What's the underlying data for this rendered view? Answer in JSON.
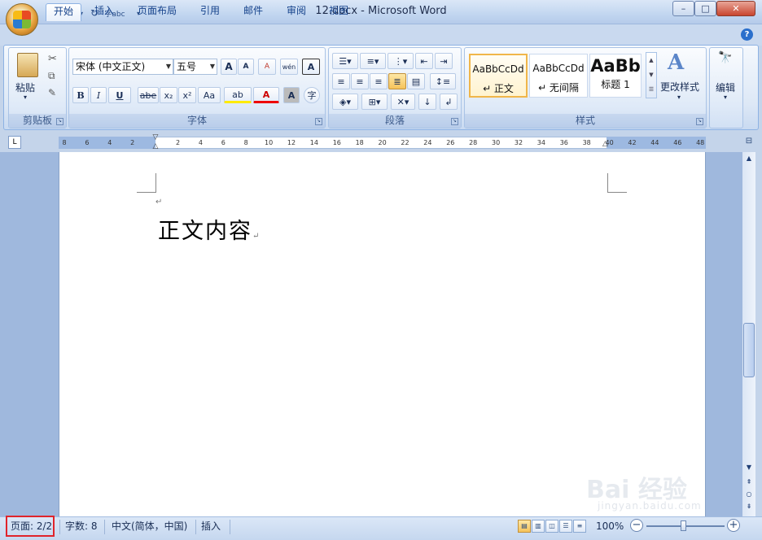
{
  "window": {
    "title": "12.docx - Microsoft Word",
    "min": "–",
    "max": "□",
    "close": "✕"
  },
  "qat": {
    "save": "💾",
    "undo": "↶",
    "redo": "↻",
    "abc": "字abc",
    "more": "▾"
  },
  "tabs": [
    {
      "label": "开始",
      "active": true
    },
    {
      "label": "插入"
    },
    {
      "label": "页面布局"
    },
    {
      "label": "引用"
    },
    {
      "label": "邮件"
    },
    {
      "label": "审阅"
    },
    {
      "label": "视图"
    }
  ],
  "clipboard": {
    "paste": "粘贴",
    "group": "剪贴板"
  },
  "font": {
    "family": "宋体 (中文正文)",
    "size": "五号",
    "grow": "A",
    "shrink": "A",
    "clear": "A",
    "phonetic": "wén",
    "border_char": "A",
    "bold": "B",
    "italic": "I",
    "underline": "U",
    "strike": "abe",
    "sub": "x₂",
    "sup": "x²",
    "case": "Aa",
    "highlight": "ab",
    "color": "A",
    "shade": "A",
    "enclose": "字",
    "group": "字体"
  },
  "paragraph": {
    "group": "段落"
  },
  "styles": {
    "items": [
      {
        "preview": "AaBbCcDd",
        "name": "↵ 正文"
      },
      {
        "preview": "AaBbCcDd",
        "name": "↵ 无间隔"
      },
      {
        "preview": "AaBb",
        "name": "标题 1"
      }
    ],
    "change": "更改样式",
    "change_icon": "A",
    "group": "样式"
  },
  "editing": {
    "label": "编辑",
    "icon": "🔭"
  },
  "ruler": {
    "selector": "L",
    "ticks": [
      "8",
      "6",
      "4",
      "2",
      "",
      "2",
      "4",
      "6",
      "8",
      "10",
      "12",
      "14",
      "16",
      "18",
      "20",
      "22",
      "24",
      "26",
      "28",
      "30",
      "32",
      "34",
      "36",
      "38",
      "40",
      "42",
      "44",
      "46",
      "48"
    ]
  },
  "document": {
    "mark1": "↵",
    "body": "正文内容",
    "mark2": "↵"
  },
  "status": {
    "page": "页面: 2/2",
    "words": "字数: 8",
    "lang": "中文(简体，中国)",
    "mode": "插入",
    "zoom": "100%",
    "zoom_level": 1.0,
    "minus": "−",
    "plus": "+"
  },
  "watermark": {
    "big": "Bai 经验",
    "small": "jingyan.baidu.com"
  }
}
